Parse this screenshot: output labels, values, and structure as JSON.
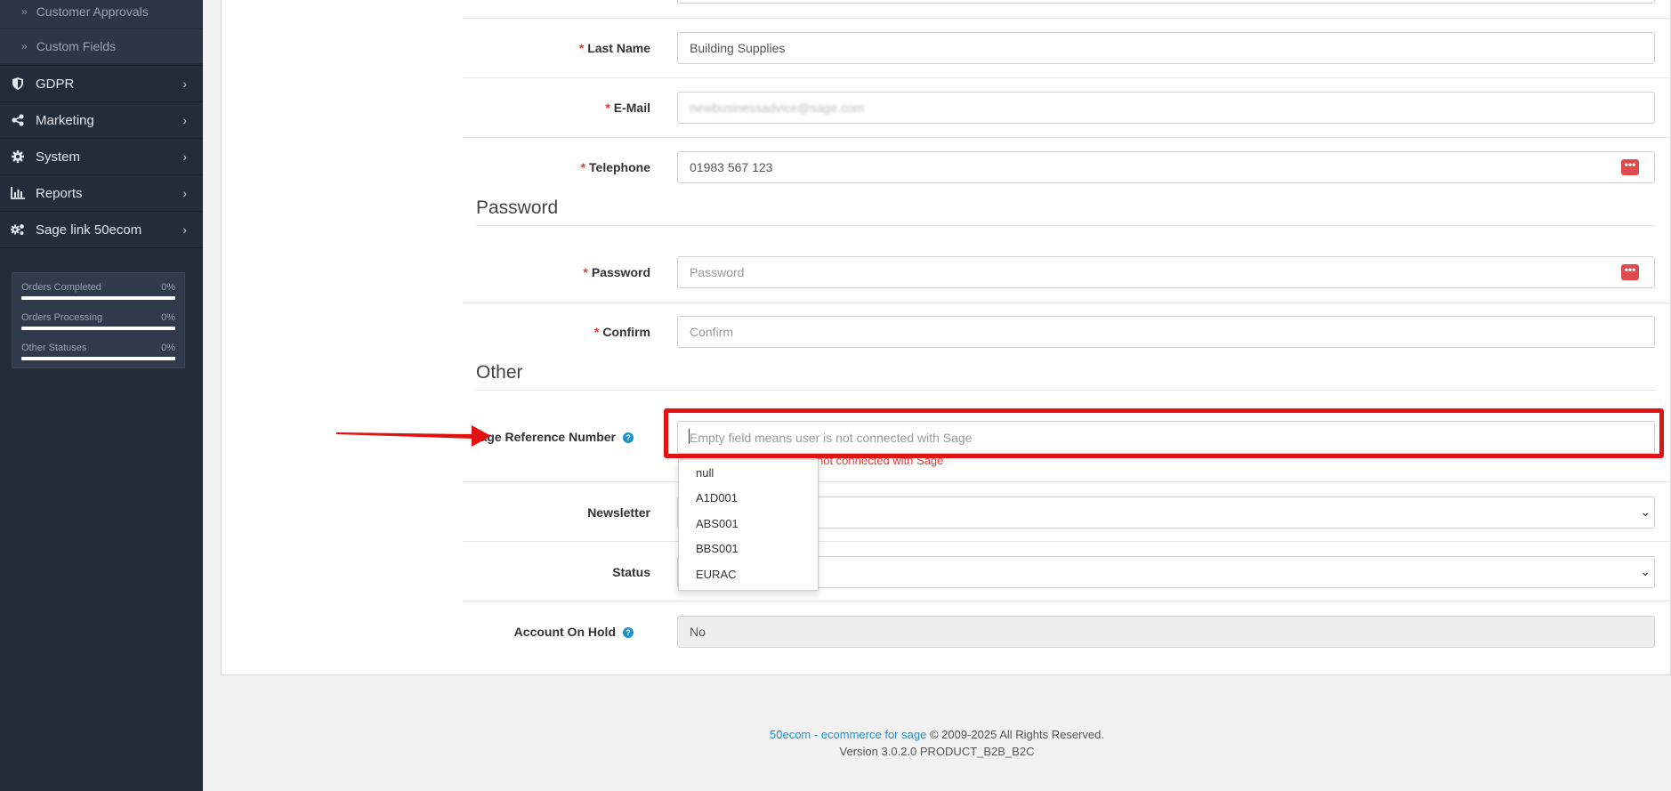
{
  "sidebar": {
    "sub_items": [
      "Customer Approvals",
      "Custom Fields"
    ],
    "items": [
      {
        "label": "GDPR",
        "icon": "shield-icon"
      },
      {
        "label": "Marketing",
        "icon": "share-icon"
      },
      {
        "label": "System",
        "icon": "gear-icon"
      },
      {
        "label": "Reports",
        "icon": "bar-chart-icon"
      },
      {
        "label": "Sage link 50ecom",
        "icon": "gears-icon"
      }
    ],
    "stats": [
      {
        "label": "Orders Completed",
        "value": "0%",
        "fill_fraction": 0
      },
      {
        "label": "Orders Processing",
        "value": "0%",
        "fill_fraction": 0
      },
      {
        "label": "Other Statuses",
        "value": "0%",
        "fill_fraction": 0
      }
    ]
  },
  "form": {
    "last_name": {
      "label": "Last Name",
      "value": "Building Supplies"
    },
    "email": {
      "label": "E-Mail",
      "value": "newbusinessadvice@sage.com"
    },
    "telephone": {
      "label": "Telephone",
      "value": "01983 567 123"
    },
    "password_section": "Password",
    "password": {
      "label": "Password",
      "placeholder": "Password"
    },
    "confirm": {
      "label": "Confirm",
      "placeholder": "Confirm"
    },
    "other_section": "Other",
    "sage_ref": {
      "label": "Sage Reference Number",
      "placeholder": "Empty field means user is not connected with Sage",
      "hint": "not connected with Sage",
      "options": [
        "null",
        "A1D001",
        "ABS001",
        "BBS001",
        "EURAC"
      ]
    },
    "newsletter": {
      "label": "Newsletter"
    },
    "status": {
      "label": "Status"
    },
    "account_on_hold": {
      "label": "Account On Hold",
      "value": "No"
    },
    "required_mark": "*",
    "help_mark": "?"
  },
  "footer": {
    "link": "50ecom - ecommerce for sage",
    "copyright": "© 2009-2025 All Rights Reserved.",
    "version": "Version 3.0.2.0 PRODUCT_B2B_B2C"
  },
  "colors": {
    "sidebar_bg": "#232c39",
    "required": "#e53935",
    "accent": "#1e91cf",
    "annotation": "#e11212"
  }
}
